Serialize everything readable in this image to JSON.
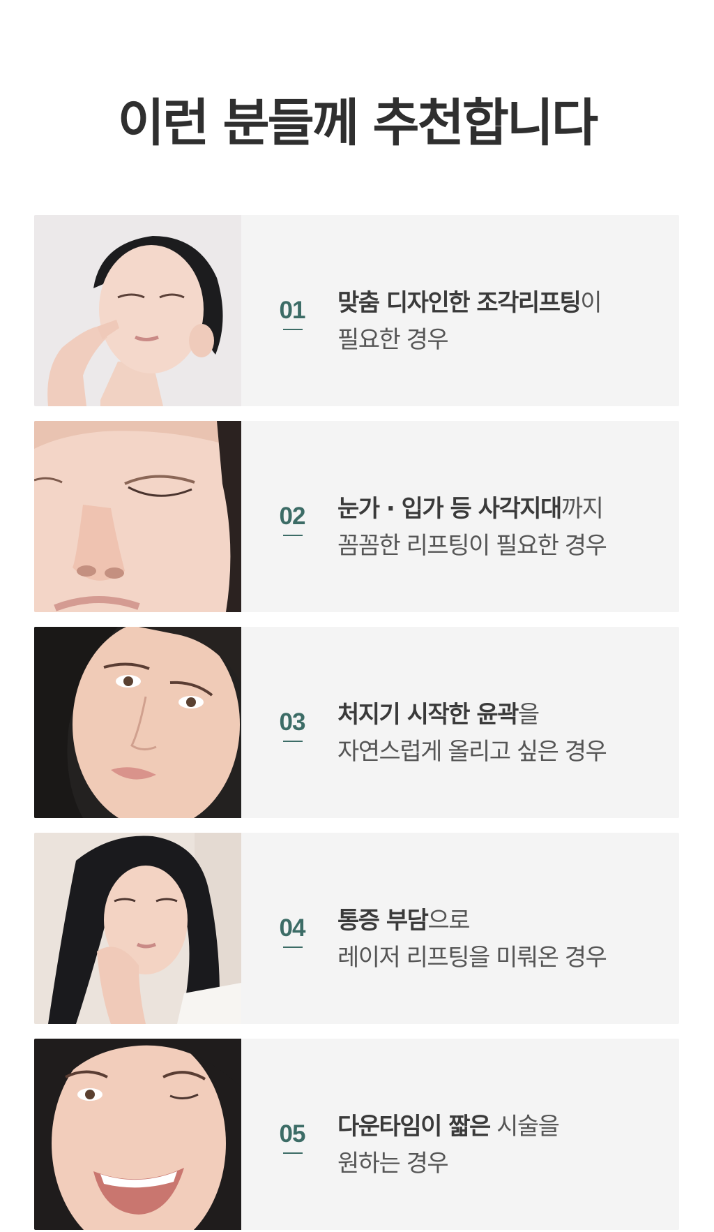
{
  "title": "이런 분들께 추천합니다",
  "items": [
    {
      "number": "01",
      "line1_strong": "맞춤 디자인한 조각리프팅",
      "line1_plain": "이",
      "line2": "필요한 경우",
      "photo_icon": "woman-touching-lip-photo"
    },
    {
      "number": "02",
      "line1_strong": "눈가 · 입가 등 사각지대",
      "line1_plain": "까지",
      "line2": "꼼꼼한 리프팅이 필요한 경우",
      "photo_icon": "closed-eye-closeup-photo"
    },
    {
      "number": "03",
      "line1_strong": "처지기 시작한 윤곽",
      "line1_plain": "을",
      "line2": "자연스럽게 올리고 싶은 경우",
      "photo_icon": "woman-face-closeup-photo"
    },
    {
      "number": "04",
      "line1_strong": "통증 부담",
      "line1_plain": "으로",
      "line2": "레이저 리프팅을 미뤄온 경우",
      "photo_icon": "woman-hand-on-cheek-photo"
    },
    {
      "number": "05",
      "line1_strong": "다운타임이 짧은",
      "line1_plain": " 시술을",
      "line2": "원하는 경우",
      "photo_icon": "woman-smiling-wink-photo"
    }
  ],
  "colors": {
    "accent": "#3c6c66",
    "card_bg": "#f4f4f4",
    "title": "#2f2f2f"
  }
}
